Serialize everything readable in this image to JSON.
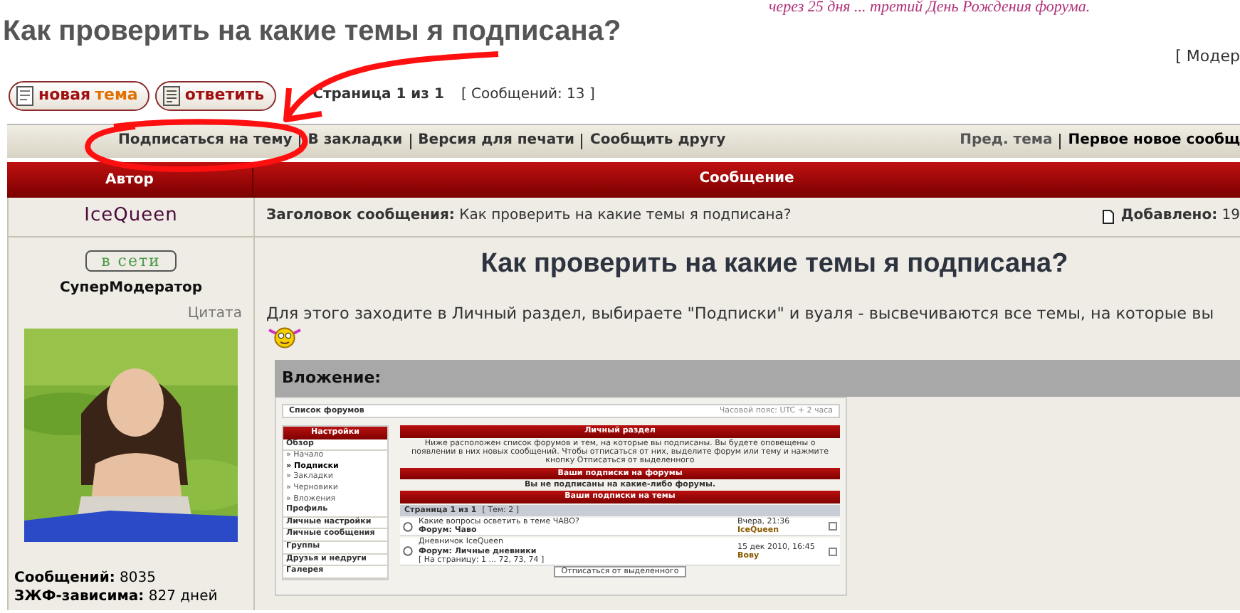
{
  "banner": "через 25 дня ... третий День Рождения форума.",
  "title": "Как проверить на какие темы я подписана?",
  "moderators": "[ Модер",
  "buttons": [
    {
      "kind": "new_topic",
      "label": "новая",
      "accent": "тема"
    },
    {
      "kind": "reply",
      "label": "ответить"
    }
  ],
  "pagination": {
    "page": "Страница 1 из 1",
    "count": "[ Сообщений: 13 ]"
  },
  "topic_links": [
    "Подписаться на тему",
    "В закладки",
    "Версия для печати",
    "Сообщить другу"
  ],
  "nav_links": [
    {
      "label": "Пред. тема",
      "bold": false
    },
    {
      "label": "Первое новое сообщ",
      "bold": true
    }
  ],
  "columns": [
    "Автор",
    "Сообщение"
  ],
  "post": {
    "author": "IceQueen",
    "status": "в сети",
    "rank": "СуперМодератор",
    "quote": "Цитата",
    "stats": [
      {
        "label": "Сообщений:",
        "value": "8035"
      },
      {
        "label": "ЗЖФ-зависима:",
        "value": "827 дней"
      }
    ],
    "subject_label": "Заголовок сообщения:",
    "subject": "Как проверить на какие темы я подписана?",
    "added_label": "Добавлено:",
    "added_value": "19",
    "heading": "Как проверить на какие темы я подписана?",
    "text": "Для этого заходите в Личный раздел, выбираете \"Подписки\" и вуаля - высвечиваются все темы, на которые вы",
    "attachment_label": "Вложение:",
    "screenshot": {
      "header_left": "Список форумов",
      "header_right": "Часовой пояс: UTC + 2 часа",
      "menu_title": "Настройки",
      "menu": [
        {
          "label": "Обзор",
          "kind": "section"
        },
        {
          "label": "» Начало",
          "kind": "item",
          "selected": false
        },
        {
          "label": "» Подписки",
          "kind": "item",
          "selected": true
        },
        {
          "label": "» Закладки",
          "kind": "item",
          "selected": false
        },
        {
          "label": "» Черновики",
          "kind": "item",
          "selected": false
        },
        {
          "label": "» Вложения",
          "kind": "item",
          "selected": false
        },
        {
          "label": "Профиль",
          "kind": "section"
        },
        {
          "label": "Личные настройки",
          "kind": "section"
        },
        {
          "label": "Личные сообщения",
          "kind": "section"
        },
        {
          "label": "Группы",
          "kind": "section"
        },
        {
          "label": "Друзья и недруги",
          "kind": "section"
        },
        {
          "label": "Галерея",
          "kind": "section"
        }
      ],
      "panel_title": "Личный раздел",
      "description": "Ниже расположен список форумов и тем, на которые вы подписаны. Вы будете оповещены о появлении в них новых сообщений. Чтобы отписаться от них, выделите форум или тему и нажмите кнопку Отписаться от выделенного",
      "forums_title": "Ваши подписки на форумы",
      "forums_empty": "Вы не подписаны на какие-либо форумы.",
      "topics_title": "Ваши подписки на темы",
      "page": "Страница 1 из 1",
      "topic_count": "[ Тем: 2 ]",
      "topics": [
        {
          "title": "Какие вопросы осветить в теме ЧАВО?",
          "forum": "Форум: Чаво",
          "date": "Вчера, 21:36",
          "author": "IceQueen",
          "checked": false
        },
        {
          "title": "Дневничок IceQueen",
          "forum": "Форум: Личные дневники",
          "pages": "[ На страницу: 1 ... 72, 73, 74 ]",
          "date": "15 дек 2010, 16:45",
          "author": "Вову",
          "checked": false
        }
      ],
      "unsubscribe": "Отписаться от выделенного"
    }
  }
}
